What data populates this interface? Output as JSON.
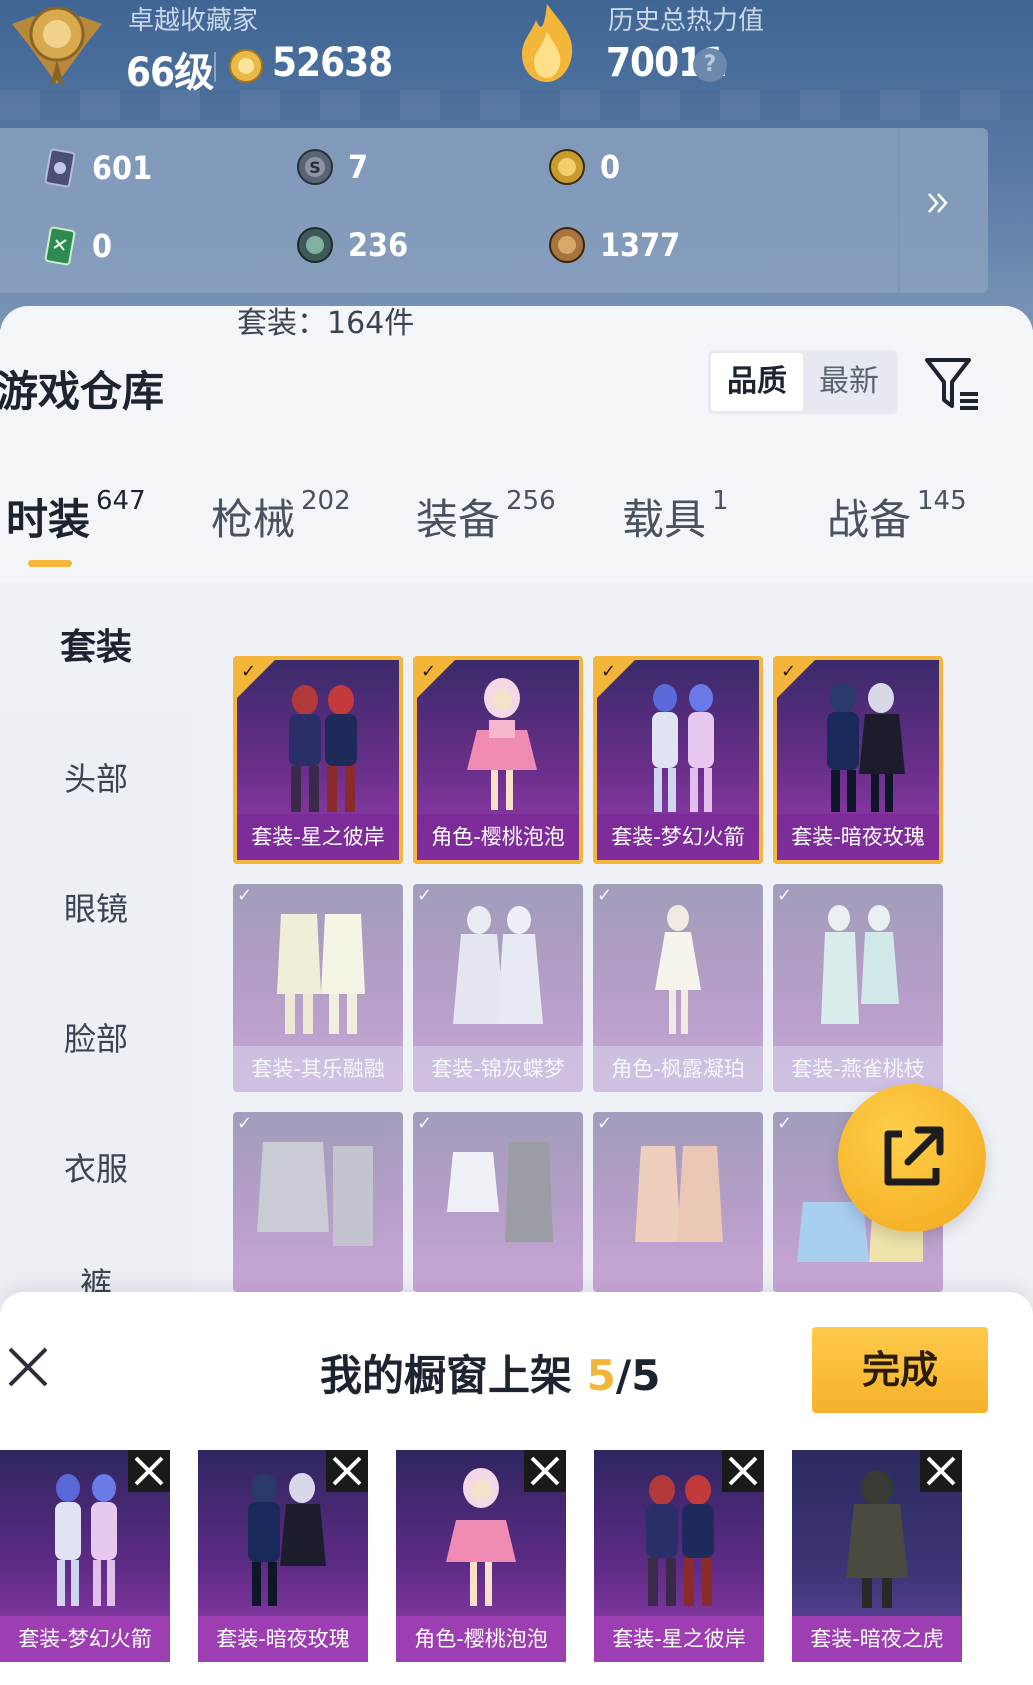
{
  "profile": {
    "rank_title": "卓越收藏家",
    "level": "66级",
    "coins": "52638",
    "heat_label": "历史总热力值",
    "heat_value": "70011",
    "help_glyph": "?"
  },
  "resources": [
    {
      "icon": "card-pack-icon",
      "value": "601"
    },
    {
      "icon": "s-token-icon",
      "value": "7"
    },
    {
      "icon": "gold-emblem-icon",
      "value": "0"
    },
    {
      "icon": "green-ticket-icon",
      "value": "0"
    },
    {
      "icon": "green-coin-icon",
      "value": "236"
    },
    {
      "icon": "bronze-coin-icon",
      "value": "1377"
    }
  ],
  "warehouse": {
    "title": "游戏仓库",
    "sort_options": [
      "品质",
      "最新"
    ],
    "active_sort": "品质"
  },
  "tabs": [
    {
      "label": "时装",
      "count": "647"
    },
    {
      "label": "枪械",
      "count": "202"
    },
    {
      "label": "装备",
      "count": "256"
    },
    {
      "label": "载具",
      "count": "1"
    },
    {
      "label": "战备",
      "count": "145"
    }
  ],
  "categories": [
    "套装",
    "头部",
    "眼镜",
    "脸部",
    "衣服",
    "裤"
  ],
  "section_header": "套装：164件",
  "items": [
    {
      "name": "套装-星之彼岸",
      "selected": true
    },
    {
      "name": "角色-樱桃泡泡",
      "selected": true
    },
    {
      "name": "套装-梦幻火箭",
      "selected": true
    },
    {
      "name": "套装-暗夜玫瑰",
      "selected": true
    },
    {
      "name": "套装-其乐融融",
      "selected": false
    },
    {
      "name": "套装-锦灰蝶梦",
      "selected": false
    },
    {
      "name": "角色-枫露凝珀",
      "selected": false
    },
    {
      "name": "套装-燕雀桃枝",
      "selected": false
    },
    {
      "name": "",
      "selected": false
    },
    {
      "name": "",
      "selected": false
    },
    {
      "name": "",
      "selected": false
    },
    {
      "name": "",
      "selected": false
    }
  ],
  "showcase": {
    "title_prefix": "我的橱窗上架 ",
    "current": "5",
    "max": "/5",
    "done_label": "完成",
    "slots": [
      "套装-梦幻火箭",
      "套装-暗夜玫瑰",
      "角色-樱桃泡泡",
      "套装-星之彼岸",
      "套装-暗夜之虎"
    ]
  },
  "colors": {
    "accent": "#f4b63a",
    "card_purple": "#6a2f8a"
  }
}
